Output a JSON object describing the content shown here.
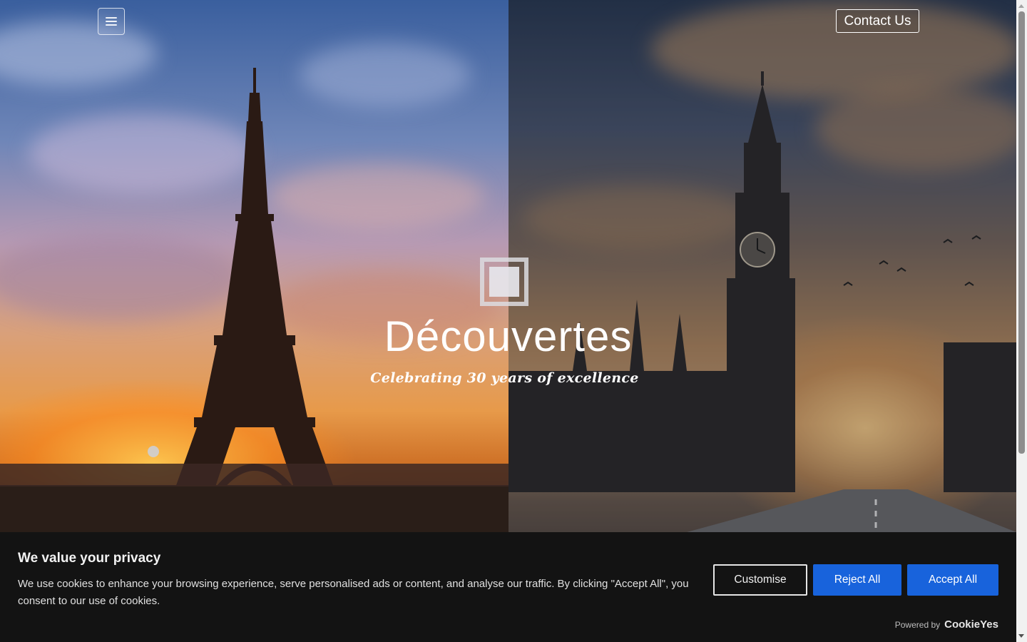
{
  "header": {
    "menu_icon": "hamburger-icon",
    "contact_label": "Contact Us"
  },
  "hero": {
    "logo_icon": "square-frame-logo",
    "title": "Découvertes",
    "subtitle": "Celebrating 30 years of excellence"
  },
  "cookie_banner": {
    "title": "We value your privacy",
    "text": "We use cookies to enhance your browsing experience, serve personalised ads or content, and analyse our traffic. By clicking \"Accept All\", you consent to our use of cookies.",
    "customise_label": "Customise",
    "reject_label": "Reject All",
    "accept_label": "Accept All",
    "powered_by": "Powered by",
    "powered_brand": "CookieYes",
    "accent_color": "#1863dc"
  }
}
